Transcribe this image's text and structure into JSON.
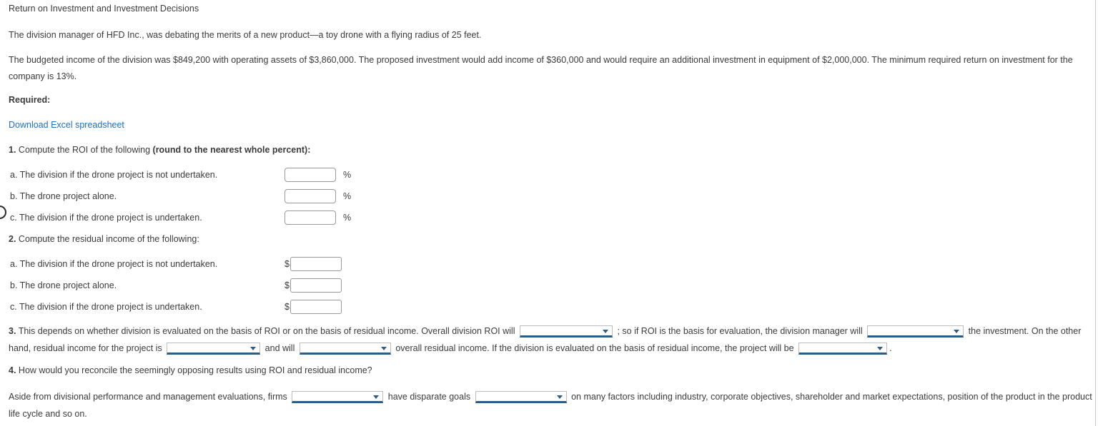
{
  "page": {
    "title": "Return on Investment and Investment Decisions",
    "intro": "The division manager of HFD Inc., was debating the merits of a new product—a toy drone with a flying radius of 25 feet.",
    "budget": "The budgeted income of the division was $849,200 with operating assets of $3,860,000. The proposed investment would add income of $360,000 and would require an additional investment in equipment of $2,000,000. The minimum required return on investment for the company is 13%.",
    "required_label": "Required:",
    "download_link": "Download Excel spreadsheet"
  },
  "q1": {
    "number": "1.",
    "text": "Compute the ROI of the following ",
    "bold_text": "(round to the nearest whole percent):",
    "rows": [
      {
        "label": "a. The division if the drone project is not undertaken.",
        "value": "",
        "unit": "%"
      },
      {
        "label": "b. The drone project alone.",
        "value": "",
        "unit": "%"
      },
      {
        "label": "c. The division if the drone project is undertaken.",
        "value": "",
        "unit": "%"
      }
    ]
  },
  "q2": {
    "number": "2.",
    "text": "Compute the residual income of the following:",
    "rows": [
      {
        "label": "a. The division if the drone project is not undertaken.",
        "prefix": "$",
        "value": ""
      },
      {
        "label": "b. The drone project alone.",
        "prefix": "$",
        "value": ""
      },
      {
        "label": "c. The division if the drone project is undertaken.",
        "prefix": "$",
        "value": ""
      }
    ]
  },
  "q3": {
    "number": "3.",
    "seg1": "This depends on whether division is evaluated on the basis of ROI or on the basis of residual income. Overall division ROI will",
    "select1": "",
    "seg2": "; so if ROI is the basis for evaluation, the division manager will",
    "select2": "",
    "seg3": "the investment. On the other hand, residual income for the project is",
    "select3": "",
    "seg4": "and will",
    "select4": "",
    "seg5": "overall residual income. If the division is evaluated on the basis of residual income, the project will be",
    "select5": "",
    "seg6": "."
  },
  "q4": {
    "number": "4.",
    "text": "How would you reconcile the seemingly opposing results using ROI and residual income?"
  },
  "closing": {
    "seg1": "Aside from divisional performance and management evaluations, firms",
    "select1": "",
    "seg2": "have disparate goals",
    "select2": "",
    "seg3": "on many factors including industry, corporate objectives, shareholder and market expectations, position of the product in the product life cycle and so on."
  },
  "colors": {
    "link": "#1f6fc4",
    "select_underline": "#2c5d84",
    "text": "#3b3b3b"
  }
}
